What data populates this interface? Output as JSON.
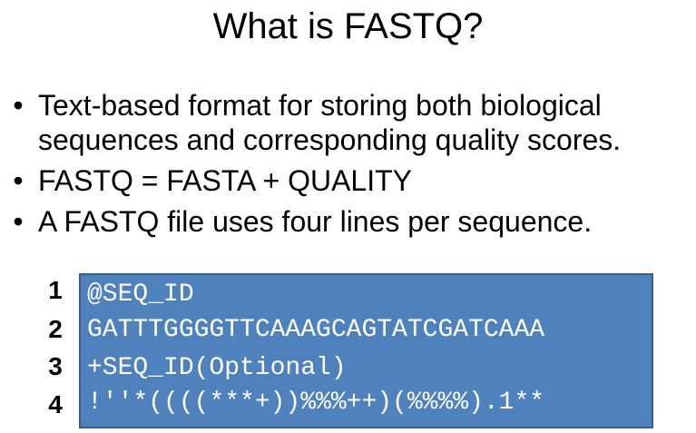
{
  "title": "What is FASTQ?",
  "bullets": [
    {
      "marker": "•",
      "lines": [
        "Text-based format for storing both biological",
        "sequences and corresponding quality scores."
      ]
    },
    {
      "marker": "•",
      "lines": [
        "FASTQ = FASTA + QUALITY"
      ]
    },
    {
      "marker": "•",
      "lines": [
        "A FASTQ file uses four lines per sequence."
      ]
    }
  ],
  "example": {
    "line_numbers": [
      "1",
      "2",
      "3",
      "4"
    ],
    "lines": [
      "@SEQ_ID",
      "GATTTGGGGTTCAAAGCAGTATCGATCAAA",
      "+SEQ_ID(Optional)",
      "!''*((((***+))%%%++)(%%%%).1**"
    ],
    "box_color": "#4f81bd",
    "text_color": "#ffffff"
  }
}
